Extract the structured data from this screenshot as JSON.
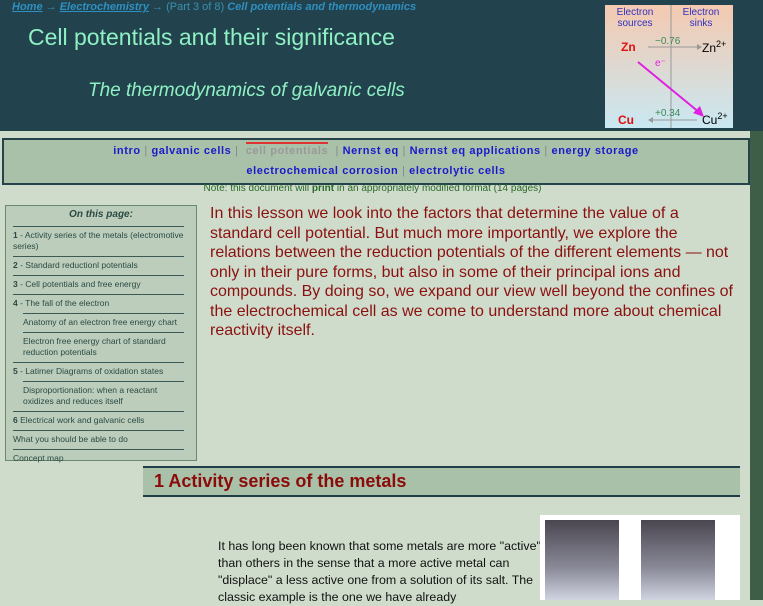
{
  "breadcrumb": {
    "home": "Home",
    "arrow": "→",
    "electrochemistry": "Electrochemistry",
    "part": "(Part 3 of 8)",
    "current": "Cell potentials and thermodynamics"
  },
  "header": {
    "title": "Cell potentials and their significance",
    "subtitle": "The thermodynamics of galvanic cells"
  },
  "figure": {
    "sources": "Electron sources",
    "sinks": "Electron sinks",
    "zn": "Zn",
    "zn2": "Zn",
    "zn_v": "−0.76",
    "cu": "Cu",
    "cu2": "Cu",
    "cu_v": "+0.34",
    "charge": "2+",
    "e": "e⁻"
  },
  "nav": {
    "row1": [
      "intro",
      "galvanic cells",
      "cell potentials",
      "Nernst eq",
      "Nernst eq applications",
      "energy storage"
    ],
    "row2": [
      "electrochemical corrosion",
      "electrolytic cells"
    ],
    "sep": "|"
  },
  "note": {
    "pre": "Note: this document will ",
    "bold": "print",
    "post": " in an appropriately modified format (14 pages)"
  },
  "toc": {
    "heading": "On this page:",
    "items": [
      {
        "num": "1",
        "text": " - Activity series of the metals (electromotive series)"
      },
      {
        "num": "2",
        "text": " - Standard reductionl potentials"
      },
      {
        "num": "3",
        "text": " - Cell potentials and free energy"
      },
      {
        "num": "4",
        "text": " - The fall of the electron"
      },
      {
        "num": "",
        "text": "Anatomy of an electron free energy chart",
        "sub": true
      },
      {
        "num": "",
        "text": "Electron free energy chart of standard reduction potentials",
        "sub": true
      },
      {
        "num": "5",
        "text": " - Latimer Diagrams of oxidation states"
      },
      {
        "num": "",
        "text": "Disproportionation: when a reactant oxidizes and reduces itself",
        "sub": true
      },
      {
        "num": "6",
        "text": " Electrical work and galvanic cells"
      },
      {
        "num": "",
        "text": "What you should be able to do"
      },
      {
        "num": "",
        "text": "Concept map"
      }
    ]
  },
  "intro": "In this lesson we look into the factors that determine the value of a standard cell potential.  But much more importantly, we explore the relations between the reduction potentials of the different elements — not only in their pure forms, but also in some of their principal ions and compounds. By doing so, we expand our view well beyond the confines of the electrochemical cell as we come to understand more about chemical reactivity itself.",
  "section1": {
    "heading": "1  Activity series of the metals",
    "para": "It has long been known that some metals are more \"active\" than others in the sense that a more active metal can \"displace\" a less active one from a solution of its salt. The classic example is the one we have already"
  }
}
